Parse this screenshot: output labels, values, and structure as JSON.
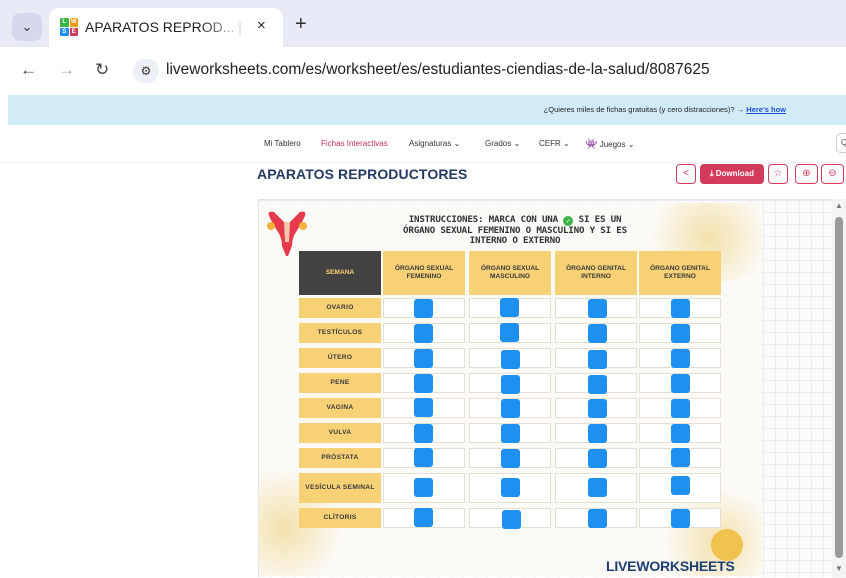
{
  "browser": {
    "tab_title": "APARATOS REPROD... | Free Inte",
    "tab_close_icon": "×",
    "new_tab_icon": "+",
    "url": "liveworksheets.com/es/worksheet/es/estudiantes-ciendias-de-la-salud/8087625",
    "favicon_letters": [
      "L",
      "W",
      "S",
      "E"
    ]
  },
  "promo": {
    "text": "¿Quieres miles de fichas gratuitas (y cero distracciones)? →",
    "link": "Here's how"
  },
  "site_nav": {
    "items": [
      "Mi Tablero",
      "Fichas Interactivas",
      "Asignaturas ⌄",
      "Grados ⌄",
      "CEFR ⌄",
      "Juegos ⌄"
    ],
    "active": "Fichas Interactivas"
  },
  "page": {
    "title": "APARATOS REPRODUCTORES",
    "download_label": "⤓ Download",
    "share_icon": "share-icon",
    "star_icon": "star-icon",
    "zoom_in_icon": "zoom-in-icon",
    "zoom_out_icon": "zoom-out-icon"
  },
  "worksheet": {
    "instructions_line1a": "INSTRUCCIONES: MARCA CON UNA",
    "instructions_line1b": "SI ES UN",
    "instructions_line2": "ÓRGANO SEXUAL FEMENINO O MASCULINO Y SI ES",
    "instructions_line3": "INTERNO O EXTERNO",
    "headers": [
      "SEMANA",
      "ÓRGANO SEXUAL FEMENINO",
      "ÓRGANO SEXUAL MASCULINO",
      "ÓRGANO GENITAL INTERNO",
      "ÓRGANO GENITAL EXTERNO"
    ],
    "rows": [
      "OVARIO",
      "TESTÍCULOS",
      "ÚTERO",
      "PENE",
      "VAGINA",
      "VULVA",
      "PRÓSTATA",
      "VESÍCULA SEMINAL",
      "CLÍTORIS"
    ],
    "checkbox_color": "#1e90f0",
    "brand": "LIVEWORKSHEETS"
  },
  "colors": {
    "accent": "#d43a5b",
    "header_yellow": "#f6d175",
    "header_dark": "#424242",
    "title_navy": "#233b61"
  }
}
